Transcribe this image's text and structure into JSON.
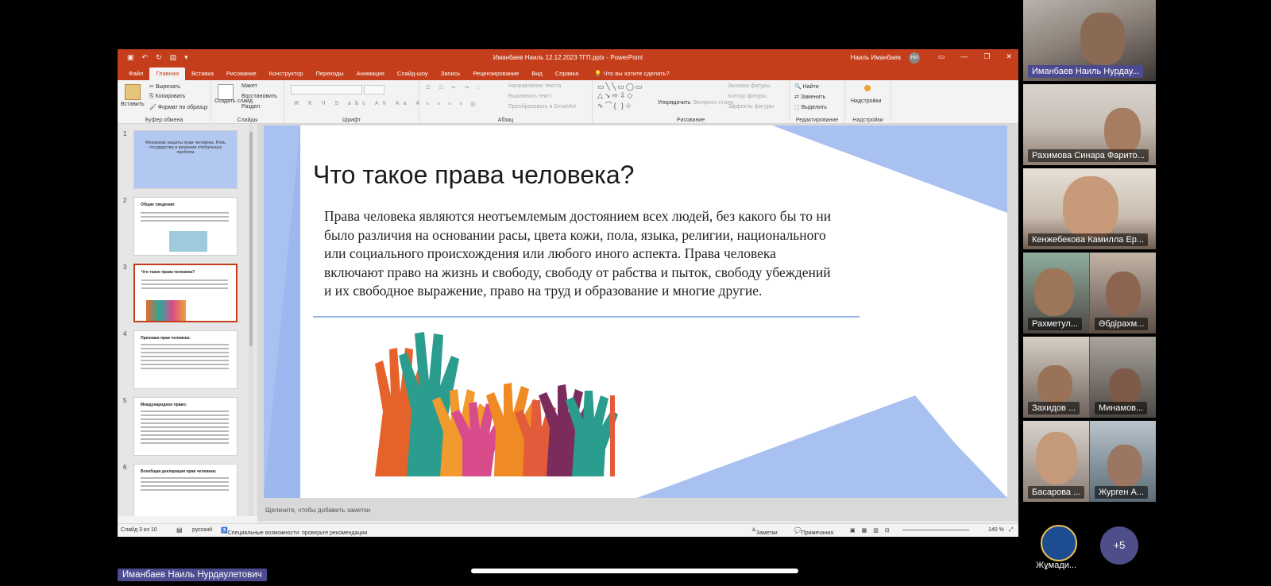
{
  "titlebar": {
    "title": "Иманбаев Наиль 12.12.2023 ТГП.pptx  -  PowerPoint",
    "user": "Наиль Иманбаев",
    "avatar_initials": "НИ",
    "quick_access": [
      "save",
      "undo",
      "redo",
      "present",
      "customize"
    ]
  },
  "tabs": [
    "Файл",
    "Главная",
    "Вставка",
    "Рисование",
    "Конструктор",
    "Переходы",
    "Анимация",
    "Слайд-шоу",
    "Запись",
    "Рецензирование",
    "Вид",
    "Справка"
  ],
  "tell_me": "Что вы хотите сделать?",
  "ribbon": {
    "clipboard": {
      "label": "Буфер обмена",
      "paste": "Вставить",
      "cut": "Вырезать",
      "copy": "Копировать",
      "format": "Формат по образцу"
    },
    "slides": {
      "label": "Слайды",
      "new": "Создать слайд",
      "layout": "Макет",
      "reset": "Восстановить",
      "section": "Раздел"
    },
    "font": {
      "label": "Шрифт"
    },
    "paragraph": {
      "label": "Абзац",
      "text_dir": "Направление текста",
      "align_text": "Выровнять текст",
      "smartart": "Преобразовать в SmartArt"
    },
    "drawing": {
      "label": "Рисование",
      "arrange": "Упорядочить",
      "quick_styles": "Экспресс-стили",
      "fill": "Заливка фигуры",
      "outline": "Контур фигуры",
      "effects": "Эффекты фигуры"
    },
    "editing": {
      "label": "Редактирование",
      "find": "Найти",
      "replace": "Заменить",
      "select": "Выделить"
    },
    "addins": {
      "label": "Надстройки",
      "btn": "Надстройки"
    }
  },
  "thumbnails": [
    {
      "num": "1",
      "title": "Механизм защиты прав человека. Роль государства в решении глобальных проблем"
    },
    {
      "num": "2",
      "title": "Общие сведения:"
    },
    {
      "num": "3",
      "title": "Что такое права человека?"
    },
    {
      "num": "4",
      "title": "Признаки прав человека:"
    },
    {
      "num": "5",
      "title": "Международное право:"
    },
    {
      "num": "6",
      "title": "Всеобщая декларация прав человека:"
    }
  ],
  "slide": {
    "title": "Что такое права человека?",
    "body": "Права человека являются неотъемлемым достоянием всех людей, без какого бы то ни было различия на основании расы, цвета кожи, пола, языка, религии, национального или социального происхождения или любого иного аспекта. Права человека включают право на жизнь и свободу, свободу от рабства и пыток, свободу убеждений и их свободное выражение, право на труд и образование и многие другие."
  },
  "notes_placeholder": "Щелкните, чтобы добавить заметки",
  "statusbar": {
    "slide": "Слайд 3 из 10",
    "language": "русский",
    "accessibility": "Специальные возможности: проверьте рекомендации",
    "notes": "Заметки",
    "comments": "Примечания",
    "zoom": "140 %"
  },
  "participants": [
    {
      "name": "Иманбаев Наиль Нурдау...",
      "speaking": true
    },
    {
      "name": "Рахимова Синара Фарито..."
    },
    {
      "name": "Кенжебекова Камилла Ер..."
    },
    {
      "name": "Рахметул...",
      "name2": "Әбдірахм..."
    },
    {
      "name": "Захидов ...",
      "name2": "Минамов..."
    },
    {
      "name": "Басарова ...",
      "name2": "Журген А..."
    }
  ],
  "self_name": "Иманбаев Наиль Нурдаулетович",
  "more_count": "+5",
  "org_name": "Жұмади...",
  "colors": {
    "ppt_accent": "#c43e1c",
    "slide_accent": "#9bb5e8",
    "speaker_badge": "#4d4b8f"
  }
}
